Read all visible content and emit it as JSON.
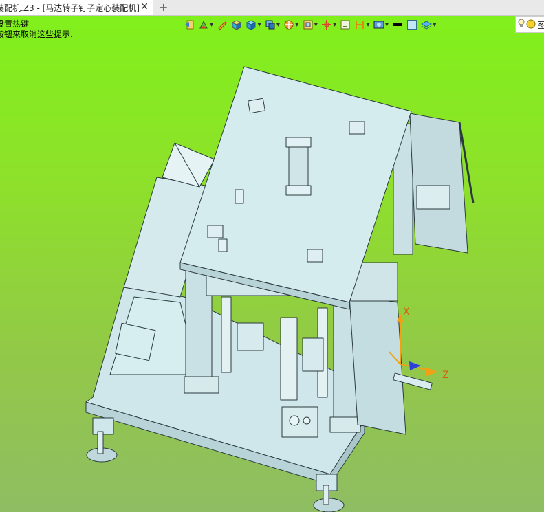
{
  "tab": {
    "title": "装配机.Z3 - [马达转子钉子定心装配机]",
    "close_glyph": "✕",
    "add_glyph": "+"
  },
  "hints": {
    "line1": "设置热键",
    "line2": "按钮来取消这些提示."
  },
  "toolbar": {
    "items": [
      "exit-icon",
      "paint-icon",
      "pencil-icon",
      "shaded-cube-icon",
      "view-cube-icon",
      "display-mode-icon",
      "filter-icon",
      "snap-icon",
      "pick-icon",
      "measure-icon",
      "section-icon",
      "screenshot-icon",
      "line-color-icon",
      "background-color-icon",
      "layer-icon"
    ]
  },
  "render": {
    "label": "图"
  },
  "axes": {
    "x": "X",
    "z": "Z"
  },
  "colors": {
    "model_face": "#cfe7ea",
    "model_edge": "#2b3a3e",
    "accent": "#f0a014",
    "axis_z": "#2a40d8",
    "axis_label": "#d65d0e"
  }
}
